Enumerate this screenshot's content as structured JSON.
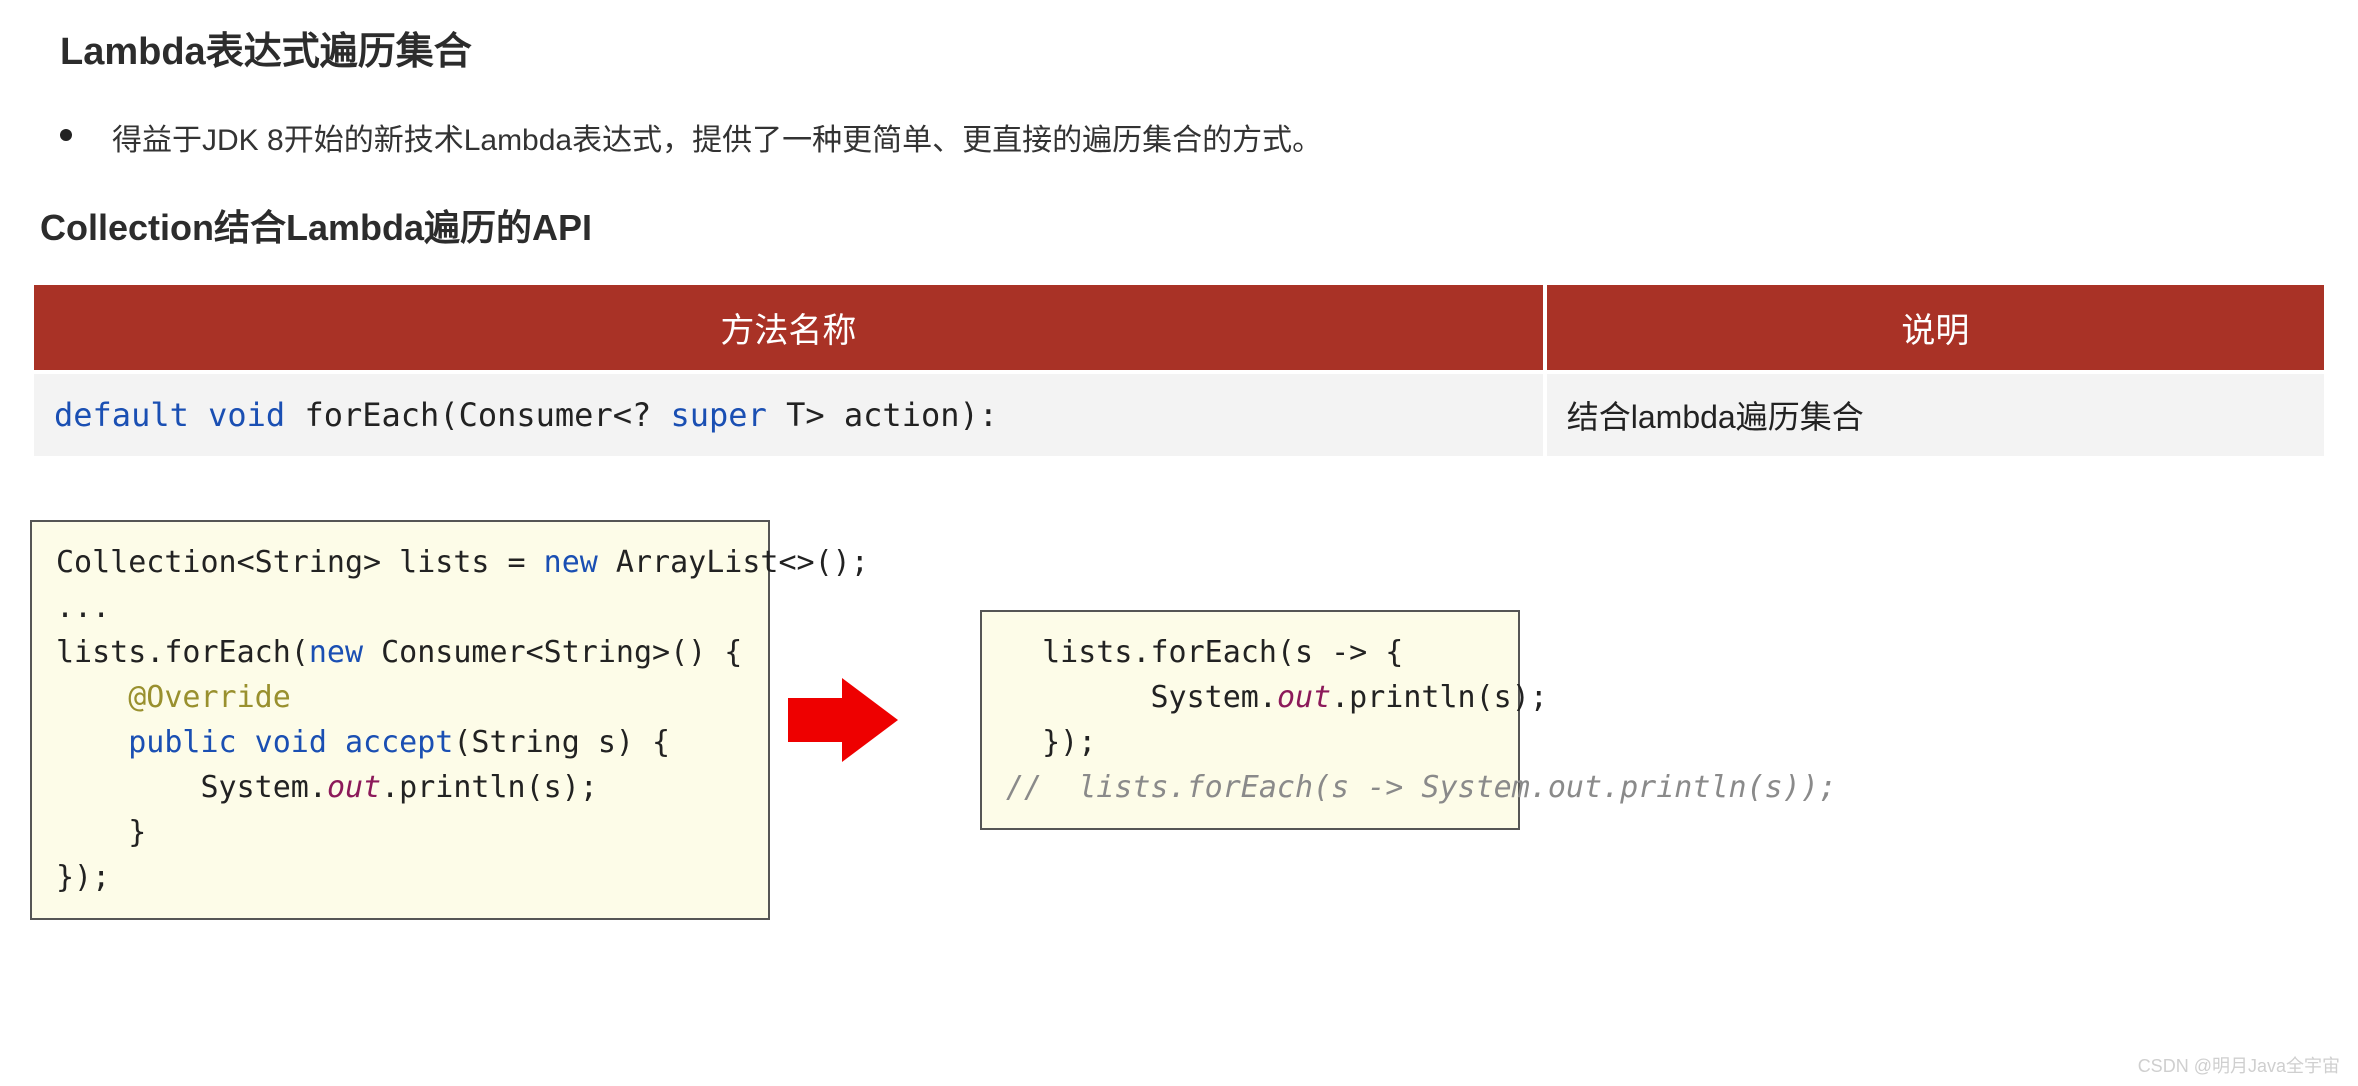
{
  "title": "Lambda表达式遍历集合",
  "bullet": "得益于JDK 8开始的新技术Lambda表达式，提供了一种更简单、更直接的遍历集合的方式。",
  "subhead": "Collection结合Lambda遍历的API",
  "table": {
    "headers": [
      "方法名称",
      "说明"
    ],
    "row": {
      "sig": {
        "p1": "default void",
        "p2": " forEach(Consumer<? ",
        "p3": "super",
        "p4": " T> action):"
      },
      "desc": "结合lambda遍历集合"
    }
  },
  "codeLeft": {
    "l1a": "Collection<String> lists = ",
    "l1b": "new",
    "l1c": " ArrayList<>();",
    "l2": "...",
    "l3a": "lists.forEach(",
    "l3b": "new",
    "l3c": " Consumer<String>() {",
    "l4": "    @Override",
    "l5a": "    public void ",
    "l5b": "accept",
    "l5c": "(String s) {",
    "l6a": "        System.",
    "l6b": "out",
    "l6c": ".println(s);",
    "l7": "    }",
    "l8": "});"
  },
  "codeRight": {
    "l1": "  lists.forEach(s -> {",
    "l2a": "        System.",
    "l2b": "out",
    "l2c": ".println(s);",
    "l3": "  });",
    "l4": "//  lists.forEach(s -> System.out.println(s));"
  },
  "watermark": "CSDN @明月Java全宇宙"
}
